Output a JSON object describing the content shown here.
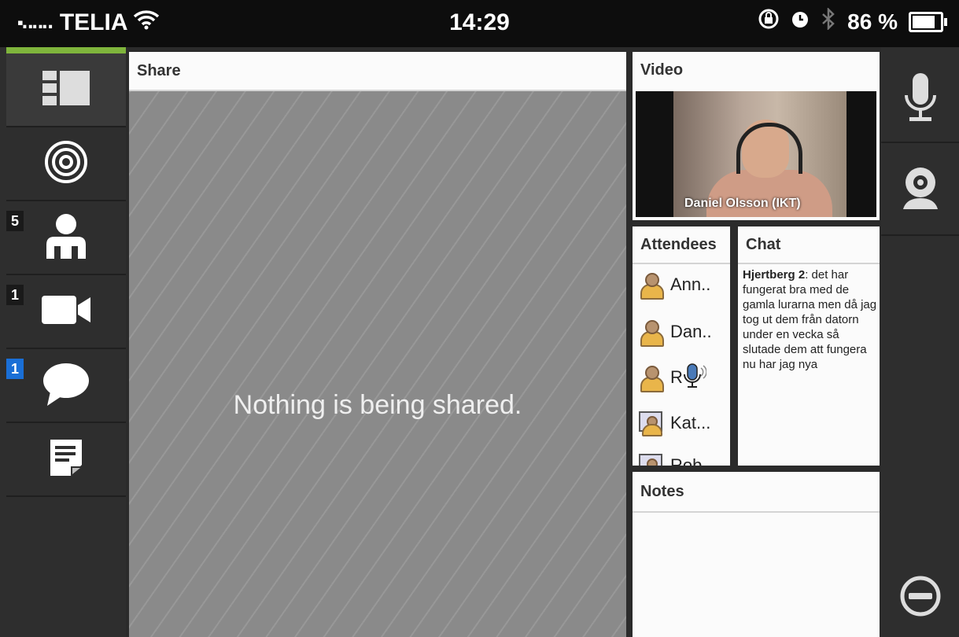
{
  "status_bar": {
    "carrier": "TELIA",
    "time": "14:29",
    "battery": "86 %"
  },
  "sidebar": {
    "accent": "#7fb53c",
    "items": [
      {
        "name": "layout",
        "badge": ""
      },
      {
        "name": "broadcast",
        "badge": ""
      },
      {
        "name": "attendees",
        "badge": "5"
      },
      {
        "name": "video",
        "badge": "1"
      },
      {
        "name": "chat",
        "badge": "1"
      },
      {
        "name": "notes",
        "badge": ""
      }
    ]
  },
  "share": {
    "title": "Share",
    "message": "Nothing is being shared."
  },
  "video": {
    "title": "Video",
    "caption": "Daniel Olsson (IKT)"
  },
  "attendees": {
    "title": "Attendees",
    "items": [
      {
        "name": "Ann..",
        "icon": "presenter-icon"
      },
      {
        "name": "Dan..",
        "icon": "presenter-icon"
      },
      {
        "name": "R",
        "icon": "presenter-icon"
      },
      {
        "name": "Kat...",
        "icon": "computer-user-icon"
      },
      {
        "name": "Rob",
        "icon": "computer-user-icon"
      }
    ]
  },
  "chat": {
    "title": "Chat",
    "sender": "Hjertberg 2",
    "message": ": det har fungerat bra med de gamla lurarna men då jag tog ut dem från datorn under en vecka  så slutade dem att fungera nu har jag nya"
  },
  "notes": {
    "title": "Notes"
  }
}
